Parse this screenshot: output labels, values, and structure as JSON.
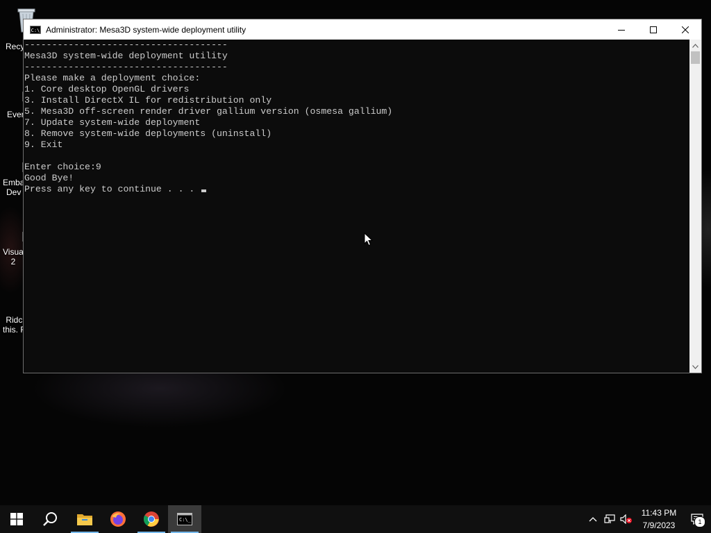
{
  "desktop": {
    "icons": [
      {
        "label": "Recy",
        "icon": "recycle-bin-icon"
      },
      {
        "label": "Ever",
        "icon": "everything-icon"
      },
      {
        "label": "Emba\nDev",
        "icon": "embarcadero-icon"
      },
      {
        "label": "Visua\n2",
        "icon": "visual-studio-icon"
      },
      {
        "label": "Ridc\nthis. F",
        "icon": "folder-icon"
      }
    ]
  },
  "window": {
    "title": "Administrator:  Mesa3D system-wide deployment utility",
    "icon": "cmd-icon",
    "controls": {
      "minimize": "minimize-icon",
      "maximize": "maximize-icon",
      "close": "close-icon"
    }
  },
  "console": {
    "lines": [
      "-------------------------------------",
      "Mesa3D system-wide deployment utility",
      "-------------------------------------",
      "Please make a deployment choice:",
      "1. Core desktop OpenGL drivers",
      "3. Install DirectX IL for redistribution only",
      "5. Mesa3D off-screen render driver gallium version (osmesa gallium)",
      "7. Update system-wide deployment",
      "8. Remove system-wide deployments (uninstall)",
      "9. Exit",
      "",
      "Enter choice:9",
      "Good Bye!",
      "Press any key to continue . . . "
    ]
  },
  "taskbar": {
    "buttons": [
      {
        "name": "start-button",
        "icon": "windows-logo-icon"
      },
      {
        "name": "search-button",
        "icon": "search-icon"
      },
      {
        "name": "file-explorer-button",
        "icon": "folder-icon"
      },
      {
        "name": "firefox-button",
        "icon": "firefox-icon"
      },
      {
        "name": "chrome-button",
        "icon": "chrome-icon"
      },
      {
        "name": "cmd-button",
        "icon": "cmd-icon",
        "active": true
      }
    ],
    "tray": {
      "icons": [
        "chevron-up-icon",
        "network-icon",
        "volume-muted-icon"
      ],
      "time": "11:43 PM",
      "date": "7/9/2023",
      "notification_count": "1"
    }
  },
  "colors": {
    "console_bg": "#0c0c0c",
    "console_text": "#cccccc",
    "taskbar_bg": "#101010",
    "accent": "#76b9ed"
  }
}
